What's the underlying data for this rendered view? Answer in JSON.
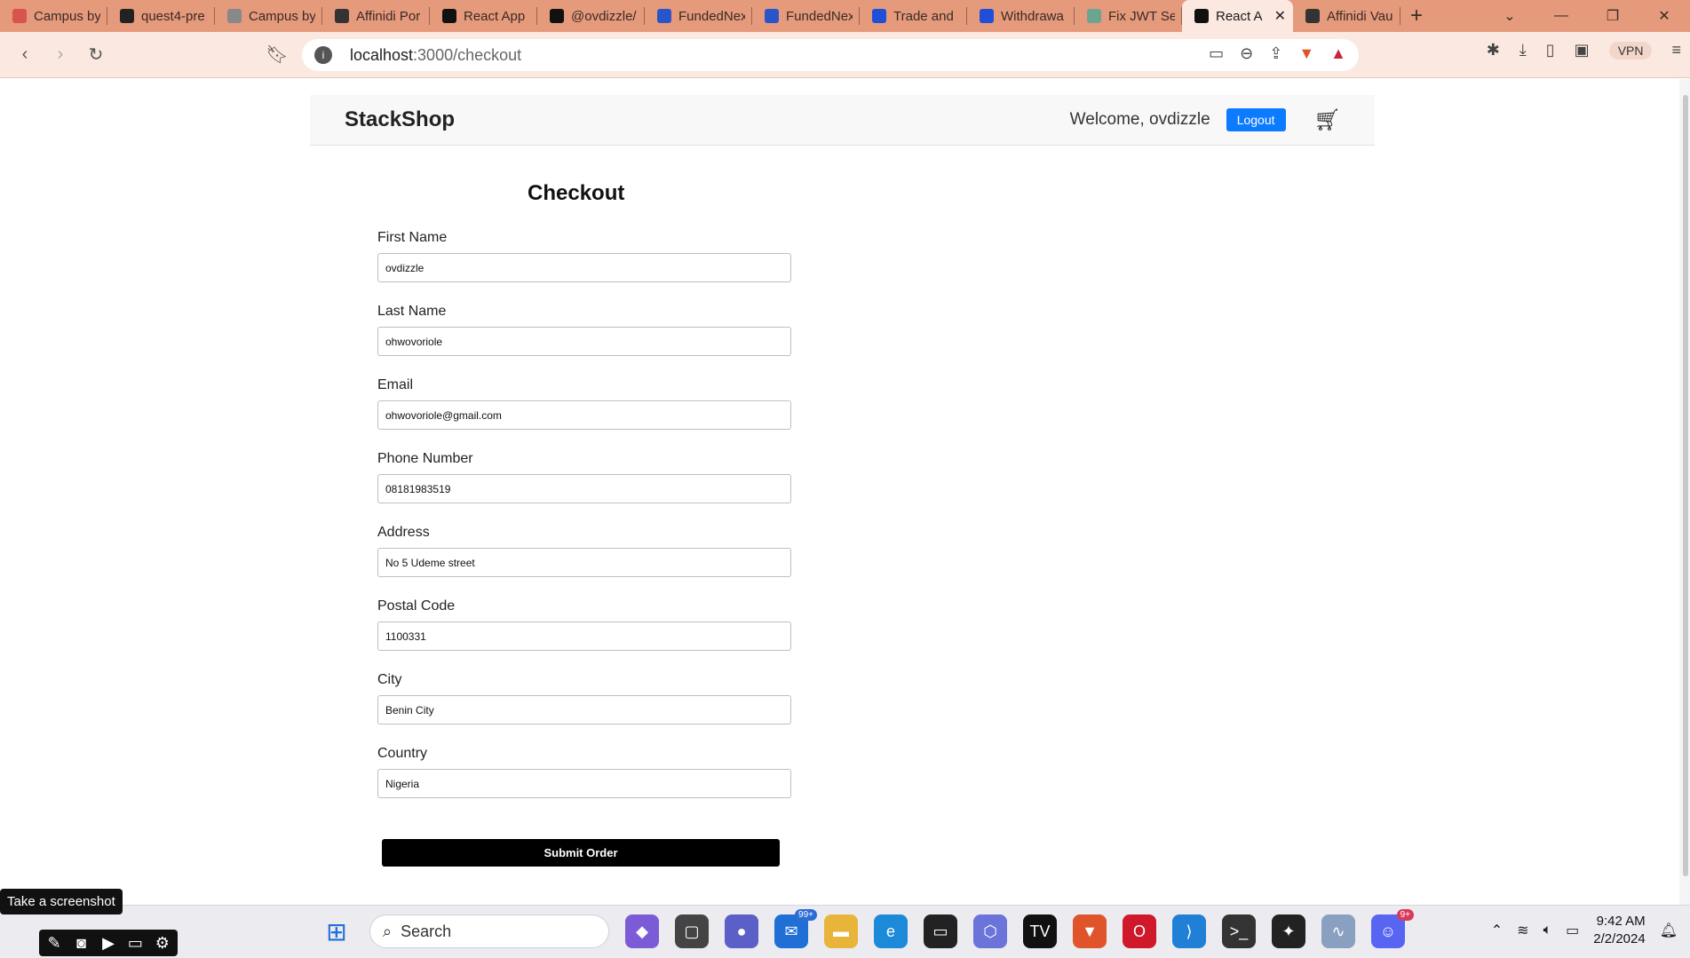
{
  "browser": {
    "tabs": [
      {
        "title": "Campus by",
        "favicon": "campus-icon",
        "color": "#d9534f"
      },
      {
        "title": "quest4-pre",
        "favicon": "github-icon",
        "color": "#222222"
      },
      {
        "title": "Campus by",
        "favicon": "campus-icon",
        "color": "#888888"
      },
      {
        "title": "Affinidi Por",
        "favicon": "doc-icon",
        "color": "#333333"
      },
      {
        "title": "React App",
        "favicon": "react-icon",
        "color": "#111111"
      },
      {
        "title": "@ovdizzle/",
        "favicon": "vercel-icon",
        "color": "#111111"
      },
      {
        "title": "FundedNex",
        "favicon": "fundednext-icon",
        "color": "#2a55c8"
      },
      {
        "title": "FundedNex",
        "favicon": "fundednext-icon",
        "color": "#2a55c8"
      },
      {
        "title": "Trade and",
        "favicon": "k-icon",
        "color": "#1e4fd6"
      },
      {
        "title": "Withdrawa",
        "favicon": "k-icon",
        "color": "#1e4fd6"
      },
      {
        "title": "Fix JWT Ses",
        "favicon": "chatgpt-icon",
        "color": "#6aa58f"
      },
      {
        "title": "React A",
        "favicon": "react-icon",
        "color": "#111111",
        "active": true
      },
      {
        "title": "Affinidi Vau",
        "favicon": "doc-icon",
        "color": "#333333"
      }
    ],
    "url_host": "localhost",
    "url_path": ":3000/checkout",
    "vpn_label": "VPN"
  },
  "header": {
    "brand": "StackShop",
    "welcome": "Welcome, ovdizzle",
    "logout_label": "Logout"
  },
  "checkout": {
    "title": "Checkout",
    "fields": [
      {
        "label": "First Name",
        "value": "ovdizzle"
      },
      {
        "label": "Last Name",
        "value": "ohwovoriole"
      },
      {
        "label": "Email",
        "value": "ohwovoriole@gmail.com"
      },
      {
        "label": "Phone Number",
        "value": "08181983519"
      },
      {
        "label": "Address",
        "value": "No 5 Udeme street"
      },
      {
        "label": "Postal Code",
        "value": "1100331"
      },
      {
        "label": "City",
        "value": "Benin City"
      },
      {
        "label": "Country",
        "value": "Nigeria"
      }
    ],
    "submit_label": "Submit Order"
  },
  "overlay": {
    "tooltip": "Take a screenshot"
  },
  "taskbar": {
    "search_placeholder": "Search",
    "mail_badge": "99+",
    "discord_badge": "9+",
    "time": "9:42 AM",
    "date": "2/2/2024"
  },
  "colors": {
    "accent_button": "#0d7bff",
    "submit_button": "#000000",
    "tabstrip": "#e59a7c"
  }
}
